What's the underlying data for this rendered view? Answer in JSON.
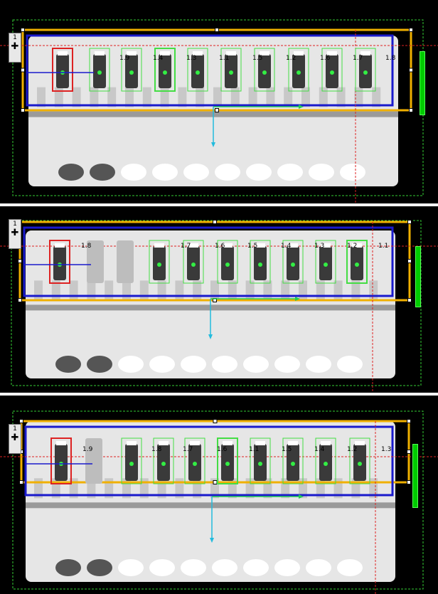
{
  "panels": [
    {
      "tool_number": "1",
      "labels": [
        "1.9",
        "1.4",
        "1.3",
        "1.1",
        "1.5",
        "1.2",
        "1.6",
        "1.7",
        "1.8"
      ]
    },
    {
      "tool_number": "1",
      "labels": [
        "1.8",
        "1.7",
        "1.6",
        "1.5",
        "1.4",
        "1.3",
        "1.2",
        "1.1"
      ]
    },
    {
      "tool_number": "1",
      "labels": [
        "1.9",
        "1.8",
        "1.7",
        "1.6",
        "1.1",
        "1.5",
        "1.4",
        "1.2",
        "1.3"
      ]
    }
  ],
  "colors": {
    "tray": "#e6e6e6",
    "tray_shadow": "#9a9a9a",
    "outer_box": "#f0b000",
    "inner_box": "#1a1acc",
    "detect_box": "#44dd44",
    "reject_box": "#dd2222",
    "guide_line": "#dd2222",
    "axis_x": "#22cc55",
    "axis_y": "#22bbdd",
    "region": "#33cc33"
  }
}
